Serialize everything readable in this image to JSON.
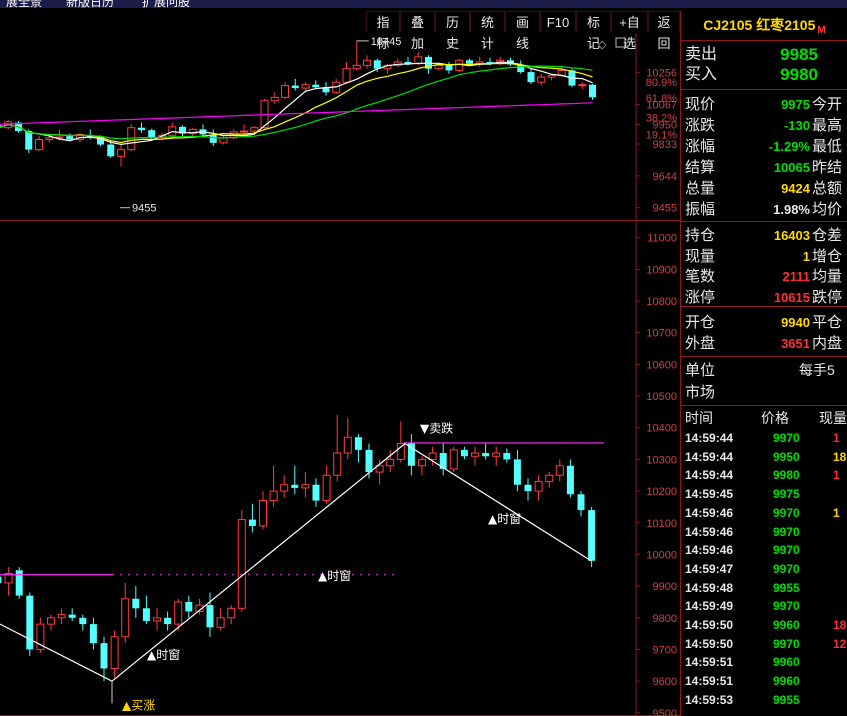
{
  "top_menu": [
    "扩展全景",
    "新版日历",
    "扩展问股"
  ],
  "toolbar": [
    "指标",
    "叠加",
    "历史",
    "统计",
    "画线",
    "F10",
    "标记",
    "+自选",
    "返回"
  ],
  "symbol": {
    "code": "CJ2105",
    "name": "红枣2105",
    "tag": "M"
  },
  "ask": {
    "label": "卖出",
    "value": "9985"
  },
  "bid": {
    "label": "买入",
    "value": "9980"
  },
  "quote_rows": [
    {
      "label": "现价",
      "value": "9975",
      "color": "green",
      "label2": "今开"
    },
    {
      "label": "涨跌",
      "value": "-130",
      "color": "green",
      "label2": "最高"
    },
    {
      "label": "涨幅",
      "value": "-1.29%",
      "color": "green",
      "label2": "最低"
    },
    {
      "label": "结算",
      "value": "10065",
      "color": "green",
      "label2": "昨结"
    },
    {
      "label": "总量",
      "value": "9424",
      "color": "yellow",
      "label2": "总额"
    },
    {
      "label": "振幅",
      "value": "1.98%",
      "color": "white",
      "label2": "均价"
    }
  ],
  "position_rows": [
    {
      "label": "持仓",
      "value": "16403",
      "color": "yellow",
      "label2": "仓差"
    },
    {
      "label": "现量",
      "value": "1",
      "color": "yellow",
      "label2": "增仓"
    },
    {
      "label": "笔数",
      "value": "2111",
      "color": "red",
      "label2": "均量"
    },
    {
      "label": "涨停",
      "value": "10615",
      "color": "red",
      "label2": "跌停"
    }
  ],
  "open_rows": [
    {
      "label": "开仓",
      "value": "9940",
      "color": "yellow",
      "label2": "平仓"
    },
    {
      "label": "外盘",
      "value": "3651",
      "color": "red",
      "label2": "内盘"
    }
  ],
  "unit": {
    "label": "单位",
    "value": "每手5"
  },
  "market": {
    "label": "市场"
  },
  "trade_header": {
    "time": "时间",
    "price": "价格",
    "vol": "现量"
  },
  "trades": [
    {
      "time": "14:59:44",
      "price": "9970",
      "vol": "1",
      "vc": "red"
    },
    {
      "time": "14:59:44",
      "price": "9950",
      "vol": "18",
      "vc": "yellow"
    },
    {
      "time": "14:59:44",
      "price": "9980",
      "vol": "1",
      "vc": "red"
    },
    {
      "time": "14:59:45",
      "price": "9975",
      "vol": "",
      "vc": "red"
    },
    {
      "time": "14:59:46",
      "price": "9970",
      "vol": "1",
      "vc": "yellow"
    },
    {
      "time": "14:59:46",
      "price": "9970",
      "vol": "",
      "vc": "red"
    },
    {
      "time": "14:59:46",
      "price": "9970",
      "vol": "",
      "vc": "red"
    },
    {
      "time": "14:59:47",
      "price": "9970",
      "vol": "",
      "vc": "red"
    },
    {
      "time": "14:59:48",
      "price": "9955",
      "vol": "",
      "vc": "red"
    },
    {
      "time": "14:59:49",
      "price": "9970",
      "vol": "",
      "vc": "red"
    },
    {
      "time": "14:59:50",
      "price": "9960",
      "vol": "18",
      "vc": "red"
    },
    {
      "time": "14:59:50",
      "price": "9970",
      "vol": "12",
      "vc": "red"
    },
    {
      "time": "14:59:51",
      "price": "9960",
      "vol": "",
      "vc": "red"
    },
    {
      "time": "14:59:51",
      "price": "9960",
      "vol": "",
      "vc": "red"
    },
    {
      "time": "14:59:53",
      "price": "9955",
      "vol": "",
      "vc": "red"
    }
  ],
  "chart_data": [
    {
      "type": "candlestick",
      "panel": "upper",
      "y_ticks": [
        "10256",
        "10067",
        "9950",
        "9833",
        "9644",
        "9455"
      ],
      "pct_ticks": [
        "80.9%",
        "61.8%",
        "38.2%",
        "19.1%"
      ],
      "ylim": [
        9400,
        10480
      ],
      "annotations": [
        {
          "text": "10445",
          "price": 10445
        },
        {
          "text": "9455",
          "price": 9455
        }
      ],
      "candles": [
        [
          9945,
          9960,
          9920,
          9930
        ],
        [
          9930,
          9975,
          9920,
          9965
        ],
        [
          9960,
          9970,
          9900,
          9910
        ],
        [
          9910,
          9920,
          9780,
          9800
        ],
        [
          9800,
          9880,
          9790,
          9860
        ],
        [
          9860,
          9880,
          9840,
          9870
        ],
        [
          9870,
          9920,
          9855,
          9875
        ],
        [
          9880,
          9895,
          9850,
          9860
        ],
        [
          9860,
          9900,
          9845,
          9890
        ],
        [
          9885,
          9920,
          9860,
          9875
        ],
        [
          9875,
          9885,
          9820,
          9830
        ],
        [
          9830,
          9855,
          9750,
          9760
        ],
        [
          9760,
          9830,
          9700,
          9800
        ],
        [
          9800,
          9950,
          9790,
          9930
        ],
        [
          9930,
          9960,
          9900,
          9915
        ],
        [
          9915,
          9925,
          9860,
          9870
        ],
        [
          9870,
          9900,
          9855,
          9885
        ],
        [
          9885,
          9960,
          9860,
          9935
        ],
        [
          9935,
          9945,
          9880,
          9895
        ],
        [
          9895,
          9930,
          9880,
          9920
        ],
        [
          9920,
          9950,
          9870,
          9890
        ],
        [
          9890,
          9920,
          9820,
          9840
        ],
        [
          9840,
          9880,
          9830,
          9870
        ],
        [
          9870,
          9920,
          9860,
          9905
        ],
        [
          9905,
          9950,
          9890,
          9910
        ],
        [
          9910,
          9940,
          9895,
          9930
        ],
        [
          9930,
          10100,
          9920,
          10090
        ],
        [
          10090,
          10140,
          10070,
          10110
        ],
        [
          10110,
          10200,
          10100,
          10180
        ],
        [
          10180,
          10220,
          10150,
          10165
        ],
        [
          10165,
          10200,
          10150,
          10185
        ],
        [
          10185,
          10210,
          10160,
          10170
        ],
        [
          10170,
          10200,
          10120,
          10140
        ],
        [
          10140,
          10220,
          10130,
          10200
        ],
        [
          10200,
          10320,
          10190,
          10280
        ],
        [
          10280,
          10445,
          10270,
          10300
        ],
        [
          10300,
          10360,
          10280,
          10330
        ],
        [
          10330,
          10340,
          10260,
          10280
        ],
        [
          10280,
          10310,
          10250,
          10300
        ],
        [
          10300,
          10340,
          10290,
          10320
        ],
        [
          10320,
          10350,
          10300,
          10310
        ],
        [
          10310,
          10380,
          10300,
          10350
        ],
        [
          10350,
          10360,
          10250,
          10280
        ],
        [
          10280,
          10310,
          10270,
          10300
        ],
        [
          10300,
          10320,
          10250,
          10270
        ],
        [
          10270,
          10340,
          10260,
          10330
        ],
        [
          10330,
          10340,
          10300,
          10310
        ],
        [
          10310,
          10350,
          10290,
          10320
        ],
        [
          10320,
          10345,
          10300,
          10310
        ],
        [
          10310,
          10350,
          10300,
          10330
        ],
        [
          10330,
          10345,
          10295,
          10305
        ],
        [
          10305,
          10330,
          10250,
          10260
        ],
        [
          10260,
          10280,
          10190,
          10200
        ],
        [
          10200,
          10250,
          10180,
          10230
        ],
        [
          10230,
          10250,
          10210,
          10240
        ],
        [
          10240,
          10290,
          10230,
          10270
        ],
        [
          10270,
          10280,
          10170,
          10180
        ],
        [
          10180,
          10200,
          10160,
          10185
        ],
        [
          10185,
          10190,
          10095,
          10110
        ]
      ]
    },
    {
      "type": "candlestick",
      "panel": "lower",
      "y_ticks": [
        "11000",
        "10900",
        "10800",
        "10700",
        "10600",
        "10500",
        "10400",
        "10300",
        "10200",
        "10100",
        "10000",
        "9900",
        "9800",
        "9700",
        "9600",
        "9500"
      ],
      "ylim": [
        9490,
        11040
      ],
      "hlines": [
        10352,
        9936
      ],
      "signals": [
        {
          "text": "▲买涨",
          "color": "#ffd900"
        },
        {
          "text": "▲时窗",
          "color": "#ffffff"
        },
        {
          "text": "▲时窗",
          "color": "#ffffff"
        },
        {
          "text": "▼卖跌",
          "color": "#ffffff"
        },
        {
          "text": "▲时窗",
          "color": "#ffffff"
        },
        {
          "text": "窗",
          "color": "#ffffff"
        }
      ],
      "candles": [
        [
          9930,
          9950,
          9890,
          9910
        ],
        [
          9910,
          9960,
          9870,
          9940
        ],
        [
          9950,
          9960,
          9860,
          9870
        ],
        [
          9870,
          9880,
          9680,
          9700
        ],
        [
          9700,
          9800,
          9690,
          9780
        ],
        [
          9780,
          9810,
          9760,
          9800
        ],
        [
          9800,
          9830,
          9780,
          9810
        ],
        [
          9810,
          9830,
          9790,
          9800
        ],
        [
          9800,
          9810,
          9760,
          9780
        ],
        [
          9780,
          9800,
          9700,
          9720
        ],
        [
          9720,
          9740,
          9600,
          9640
        ],
        [
          9640,
          9760,
          9610,
          9740
        ],
        [
          9740,
          9910,
          9720,
          9860
        ],
        [
          9860,
          9900,
          9800,
          9830
        ],
        [
          9830,
          9870,
          9780,
          9790
        ],
        [
          9790,
          9830,
          9760,
          9800
        ],
        [
          9800,
          9820,
          9760,
          9780
        ],
        [
          9780,
          9860,
          9760,
          9850
        ],
        [
          9850,
          9870,
          9800,
          9820
        ],
        [
          9820,
          9860,
          9810,
          9840
        ],
        [
          9840,
          9880,
          9740,
          9770
        ],
        [
          9770,
          9830,
          9760,
          9800
        ],
        [
          9800,
          9840,
          9780,
          9830
        ],
        [
          9830,
          10140,
          9820,
          10110
        ],
        [
          10110,
          10160,
          10070,
          10090
        ],
        [
          10090,
          10200,
          10080,
          10170
        ],
        [
          10170,
          10280,
          10150,
          10200
        ],
        [
          10200,
          10250,
          10180,
          10220
        ],
        [
          10220,
          10280,
          10190,
          10210
        ],
        [
          10210,
          10260,
          10180,
          10220
        ],
        [
          10220,
          10240,
          10150,
          10170
        ],
        [
          10170,
          10280,
          10160,
          10250
        ],
        [
          10250,
          10440,
          10230,
          10320
        ],
        [
          10320,
          10430,
          10300,
          10370
        ],
        [
          10370,
          10380,
          10290,
          10330
        ],
        [
          10330,
          10350,
          10240,
          10260
        ],
        [
          10260,
          10300,
          10220,
          10280
        ],
        [
          10280,
          10330,
          10260,
          10300
        ],
        [
          10300,
          10420,
          10290,
          10350
        ],
        [
          10350,
          10380,
          10250,
          10280
        ],
        [
          10280,
          10310,
          10250,
          10300
        ],
        [
          10300,
          10340,
          10280,
          10320
        ],
        [
          10320,
          10350,
          10250,
          10270
        ],
        [
          10270,
          10340,
          10260,
          10330
        ],
        [
          10330,
          10340,
          10300,
          10310
        ],
        [
          10310,
          10340,
          10280,
          10320
        ],
        [
          10320,
          10350,
          10300,
          10310
        ],
        [
          10310,
          10340,
          10280,
          10320
        ],
        [
          10320,
          10335,
          10290,
          10300
        ],
        [
          10300,
          10330,
          10200,
          10220
        ],
        [
          10220,
          10240,
          10170,
          10200
        ],
        [
          10200,
          10250,
          10170,
          10230
        ],
        [
          10230,
          10260,
          10210,
          10250
        ],
        [
          10250,
          10300,
          10230,
          10280
        ],
        [
          10280,
          10300,
          10180,
          10190
        ],
        [
          10190,
          10200,
          10120,
          10140
        ],
        [
          10140,
          10150,
          9960,
          9980
        ]
      ]
    }
  ]
}
